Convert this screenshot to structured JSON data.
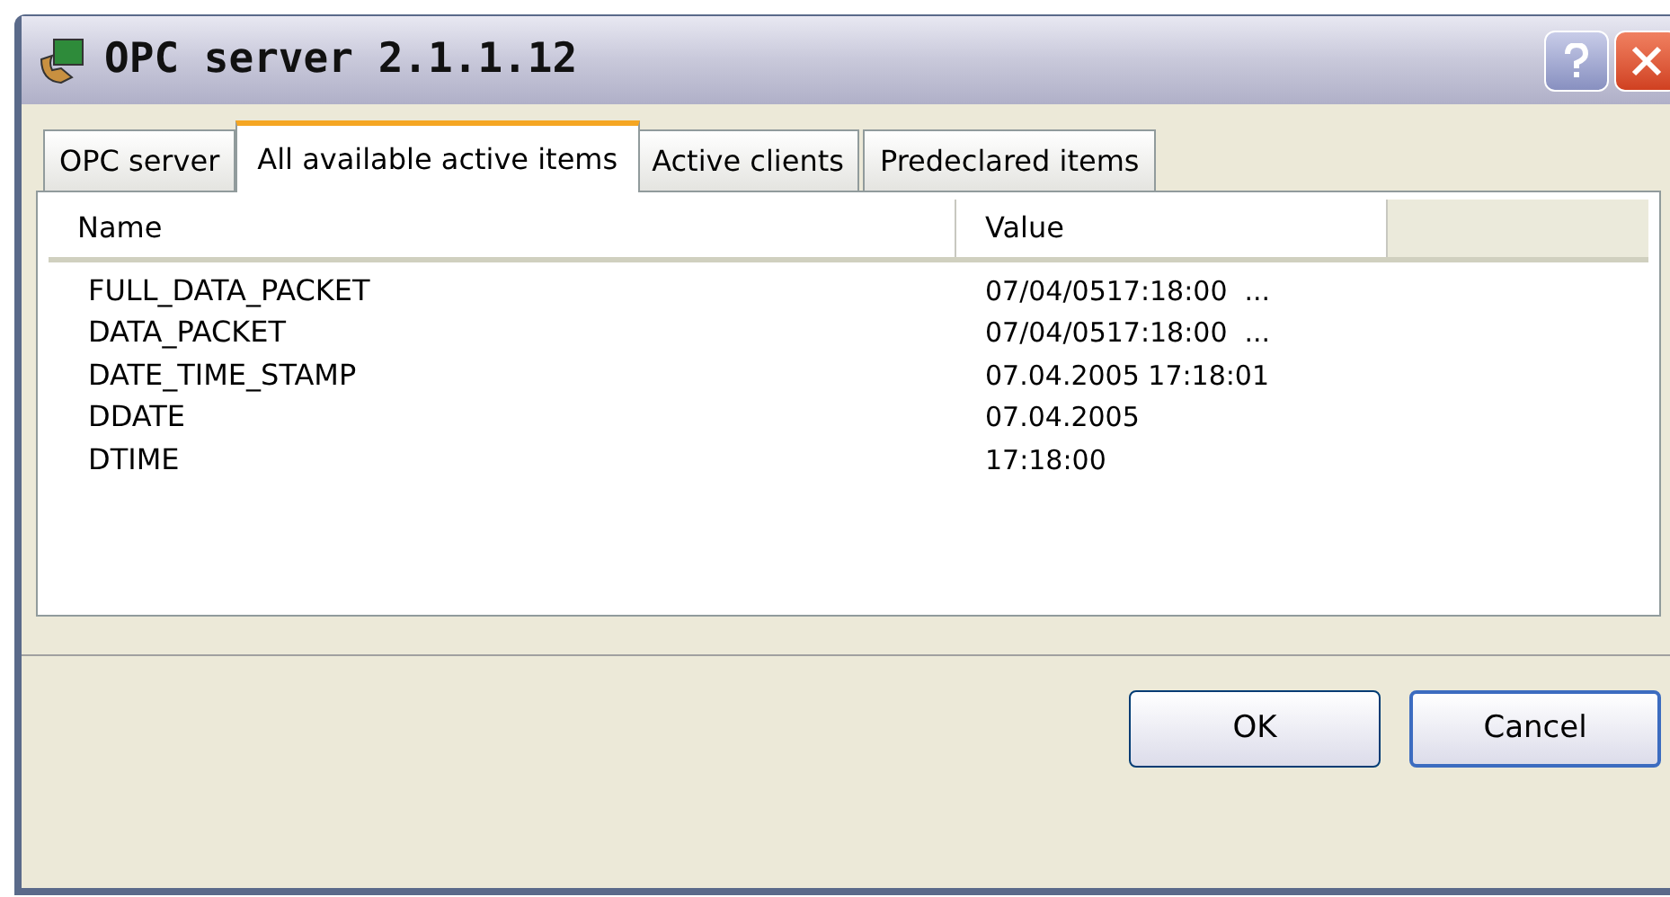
{
  "window": {
    "title": "OPC server 2.1.1.12"
  },
  "tabs": [
    {
      "label": "OPC server",
      "selected": false
    },
    {
      "label": "All available active items",
      "selected": true
    },
    {
      "label": "Active clients",
      "selected": false
    },
    {
      "label": "Predeclared items",
      "selected": false
    }
  ],
  "table": {
    "columns": [
      "Name",
      "Value"
    ],
    "rows": [
      {
        "name": "FULL_DATA_PACKET",
        "value": "07/04/0517:18:00  ..."
      },
      {
        "name": "DATA_PACKET",
        "value": "07/04/0517:18:00  ..."
      },
      {
        "name": "DATE_TIME_STAMP",
        "value": "07.04.2005 17:18:01"
      },
      {
        "name": "DDATE",
        "value": "07.04.2005"
      },
      {
        "name": "DTIME",
        "value": "17:18:00"
      }
    ]
  },
  "buttons": [
    {
      "label": "OK",
      "default": false
    },
    {
      "label": "Cancel",
      "default": true
    }
  ]
}
